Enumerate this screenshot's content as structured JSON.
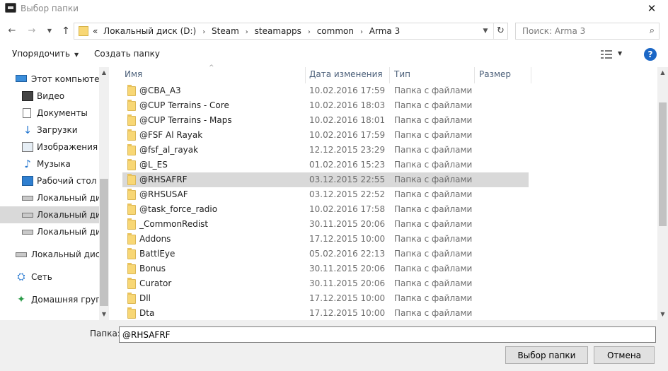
{
  "window": {
    "title": "Выбор папки",
    "close_glyph": "✕"
  },
  "nav": {
    "back_glyph": "←",
    "forward_glyph": "→",
    "dropdown_glyph": "▼",
    "up_glyph": "↑"
  },
  "address": {
    "overflow_glyph": "«",
    "crumbs": [
      "Локальный диск (D:)",
      "Steam",
      "steamapps",
      "common",
      "Arma 3"
    ],
    "chevron_glyph": "▼",
    "refresh_glyph": "↻"
  },
  "search": {
    "placeholder": "Поиск: Arma 3",
    "icon_glyph": "⌕"
  },
  "toolbar": {
    "organize_label": "Упорядочить",
    "organize_caret": "▼",
    "new_folder_label": "Создать папку",
    "view_caret": "▼",
    "help_glyph": "?"
  },
  "sidebar": {
    "items": [
      {
        "label": "Этот компьютер",
        "icon": "pc-icon"
      },
      {
        "label": "Видео",
        "icon": "video-icon"
      },
      {
        "label": "Документы",
        "icon": "documents-icon"
      },
      {
        "label": "Загрузки",
        "icon": "downloads-icon"
      },
      {
        "label": "Изображения",
        "icon": "pictures-icon"
      },
      {
        "label": "Музыка",
        "icon": "music-icon"
      },
      {
        "label": "Рабочий стол",
        "icon": "desktop-icon"
      },
      {
        "label": "Локальный диск",
        "icon": "drive-icon"
      },
      {
        "label": "Локальный диск",
        "icon": "drive-icon"
      },
      {
        "label": "Локальный диск",
        "icon": "drive-icon"
      },
      {
        "label": "Локальный диск",
        "icon": "drive-icon"
      },
      {
        "label": "Сеть",
        "icon": "network-icon"
      },
      {
        "label": "Домашняя группа",
        "icon": "homegroup-icon"
      }
    ],
    "selected_index": 8,
    "glyphs": {
      "down_arrow": "↓",
      "music_note": "♪",
      "network": "⛭",
      "homegroup": "✦"
    }
  },
  "file_list": {
    "sort_caret": "^",
    "columns": [
      "Имя",
      "Дата изменения",
      "Тип",
      "Размер"
    ],
    "rows": [
      {
        "name": "@CBA_A3",
        "date": "10.02.2016 17:59",
        "type": "Папка с файлами"
      },
      {
        "name": "@CUP Terrains - Core",
        "date": "10.02.2016 18:03",
        "type": "Папка с файлами"
      },
      {
        "name": "@CUP Terrains - Maps",
        "date": "10.02.2016 18:01",
        "type": "Папка с файлами"
      },
      {
        "name": "@FSF Al Rayak",
        "date": "10.02.2016 17:59",
        "type": "Папка с файлами"
      },
      {
        "name": "@fsf_al_rayak",
        "date": "12.12.2015 23:29",
        "type": "Папка с файлами"
      },
      {
        "name": "@L_ES",
        "date": "01.02.2016 15:23",
        "type": "Папка с файлами"
      },
      {
        "name": "@RHSAFRF",
        "date": "03.12.2015 22:55",
        "type": "Папка с файлами"
      },
      {
        "name": "@RHSUSAF",
        "date": "03.12.2015 22:52",
        "type": "Папка с файлами"
      },
      {
        "name": "@task_force_radio",
        "date": "10.02.2016 17:58",
        "type": "Папка с файлами"
      },
      {
        "name": "_CommonRedist",
        "date": "30.11.2015 20:06",
        "type": "Папка с файлами"
      },
      {
        "name": "Addons",
        "date": "17.12.2015 10:00",
        "type": "Папка с файлами"
      },
      {
        "name": "BattlEye",
        "date": "05.02.2016 22:13",
        "type": "Папка с файлами"
      },
      {
        "name": "Bonus",
        "date": "30.11.2015 20:06",
        "type": "Папка с файлами"
      },
      {
        "name": "Curator",
        "date": "30.11.2015 20:06",
        "type": "Папка с файлами"
      },
      {
        "name": "Dll",
        "date": "17.12.2015 10:00",
        "type": "Папка с файлами"
      },
      {
        "name": "Dta",
        "date": "17.12.2015 10:00",
        "type": "Папка с файлами"
      }
    ],
    "selected_index": 6
  },
  "scroll": {
    "up_glyph": "▲",
    "down_glyph": "▼"
  },
  "footer": {
    "folder_label": "Папка:",
    "folder_value": "@RHSAFRF",
    "select_button": "Выбор папки",
    "cancel_button": "Отмена"
  }
}
